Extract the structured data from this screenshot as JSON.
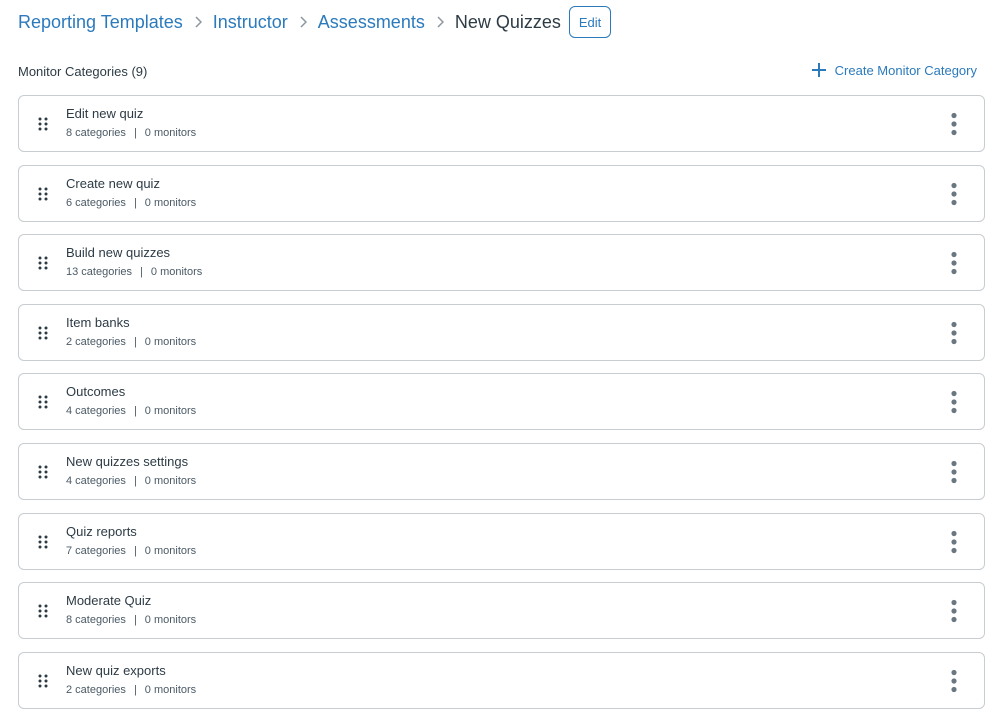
{
  "breadcrumb": {
    "items": [
      {
        "label": "Reporting Templates",
        "link": true
      },
      {
        "label": "Instructor",
        "link": true
      },
      {
        "label": "Assessments",
        "link": true
      },
      {
        "label": "New Quizzes",
        "link": false
      }
    ],
    "edit_label": "Edit"
  },
  "section": {
    "title": "Monitor Categories (9)",
    "create_label": "Create Monitor Category",
    "create_icon": "plus-icon"
  },
  "colors": {
    "link": "#2b7abc",
    "text": "#2d3b45",
    "border": "#c7cdd1",
    "kebab": "#6b7780"
  },
  "categories": [
    {
      "title": "Edit new quiz",
      "categories": "8 categories",
      "monitors": "0 monitors"
    },
    {
      "title": "Create new quiz",
      "categories": "6 categories",
      "monitors": "0 monitors"
    },
    {
      "title": "Build new quizzes",
      "categories": "13 categories",
      "monitors": "0 monitors"
    },
    {
      "title": "Item banks",
      "categories": "2 categories",
      "monitors": "0 monitors"
    },
    {
      "title": "Outcomes",
      "categories": "4 categories",
      "monitors": "0 monitors"
    },
    {
      "title": "New quizzes settings",
      "categories": "4 categories",
      "monitors": "0 monitors"
    },
    {
      "title": "Quiz reports",
      "categories": "7 categories",
      "monitors": "0 monitors"
    },
    {
      "title": "Moderate Quiz",
      "categories": "8 categories",
      "monitors": "0 monitors"
    },
    {
      "title": "New quiz exports",
      "categories": "2 categories",
      "monitors": "0 monitors"
    }
  ],
  "separator": "|"
}
